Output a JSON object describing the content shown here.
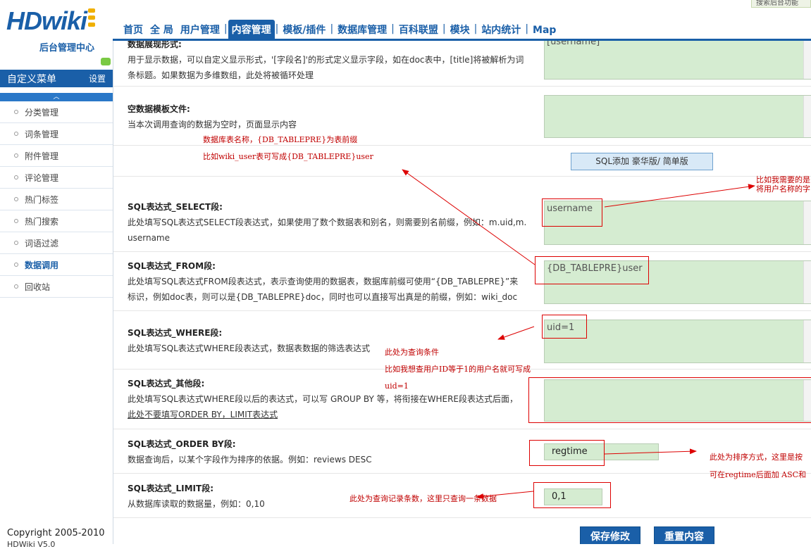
{
  "header": {
    "logo_text": "HDwiki",
    "subtitle": "后台管理中心",
    "top_tip": "搜索后台功能",
    "nav": [
      {
        "label": "首页"
      },
      {
        "label": "全 局"
      },
      {
        "label": "用户管理"
      },
      {
        "label": "内容管理",
        "active": true
      },
      {
        "label": "模板/插件"
      },
      {
        "label": "数据库管理"
      },
      {
        "label": "百科联盟"
      },
      {
        "label": "模块"
      },
      {
        "label": "站内统计"
      },
      {
        "label": "Map"
      }
    ]
  },
  "sidebar": {
    "menu_title": "自定义菜单",
    "settings_label": "设置",
    "collapse_glyph": "︿",
    "items": [
      {
        "label": "分类管理"
      },
      {
        "label": "词条管理"
      },
      {
        "label": "附件管理"
      },
      {
        "label": "评论管理"
      },
      {
        "label": "热门标签"
      },
      {
        "label": "热门搜索"
      },
      {
        "label": "词语过滤"
      },
      {
        "label": "数据调用",
        "active": true
      },
      {
        "label": "回收站"
      }
    ],
    "copyright": "Copyright 2005-2010",
    "copyright2": "HDWiki V5.0"
  },
  "form": {
    "display_format": {
      "title": "数据展现形式:",
      "desc1": "用于显示数据，可以自定义显示形式，'[字段名]'的形式定义显示字段，如在doc表中，[title]将被解析为词",
      "desc2": "条标题。如果数据为多维数组，此处将被循环处理",
      "value": "[username]"
    },
    "empty_template": {
      "title": "空数据模板文件:",
      "desc": "当本次调用查询的数据为空时，页面显示内容",
      "value": ""
    },
    "table_hint1": "数据库表名称，{DB_TABLEPRE}为表前缀",
    "table_hint2": "比如wiki_user表可写成{DB_TABLEPRE}user",
    "sql_button": "SQL添加 豪华版/ 简单版",
    "select": {
      "title": "SQL表达式_SELECT段:",
      "desc1": "此处填写SQL表达式SELECT段表达式，如果使用了数个数据表和别名，则需要别名前缀，例如：m.uid,m.",
      "desc2": "username",
      "value": "username"
    },
    "from": {
      "title": "SQL表达式_FROM段:",
      "desc1": "此处填写SQL表达式FROM段表达式，表示查询使用的数据表，数据库前缀可使用“{DB_TABLEPRE}”来",
      "desc2": "标识，例如doc表，则可以是{DB_TABLEPRE}doc，同时也可以直接写出真是的前缀，例如：wiki_doc",
      "value": "{DB_TABLEPRE}user"
    },
    "where": {
      "title": "SQL表达式_WHERE段:",
      "desc": "此处填写SQL表达式WHERE段表达式，数据表数据的筛选表达式",
      "value": "uid=1"
    },
    "other": {
      "title": "SQL表达式_其他段:",
      "desc1": "此处填写SQL表达式WHERE段以后的表达式，可以写  GROUP BY 等，将衔接在WHERE段表达式后面，",
      "desc2": "此处不要填写ORDER BY，LIMIT表达式",
      "value": ""
    },
    "orderby": {
      "title": "SQL表达式_ORDER BY段:",
      "desc": "数据查询后，以某个字段作为排序的依据。例如：reviews DESC",
      "value": "regtime"
    },
    "limit": {
      "title": "SQL表达式_LIMIT段:",
      "desc": "从数据库读取的数据量，例如：0,10",
      "value": "0,1"
    },
    "save_button": "保存修改",
    "reset_button": "重置内容"
  },
  "annotations": {
    "select_note1": "比如我需要的是",
    "select_note2": "将用户名称的字",
    "where_note1": "此处为查询条件",
    "where_note2": "比如我想查用户ID等于1的用户名就可写成",
    "where_note3": "uid=1",
    "orderby_note1": "此处为排序方式，这里是按",
    "orderby_note2": "可在regtime后面加 ASC和",
    "limit_note": "此处为查询记录条数，这里只查询一条数据"
  }
}
